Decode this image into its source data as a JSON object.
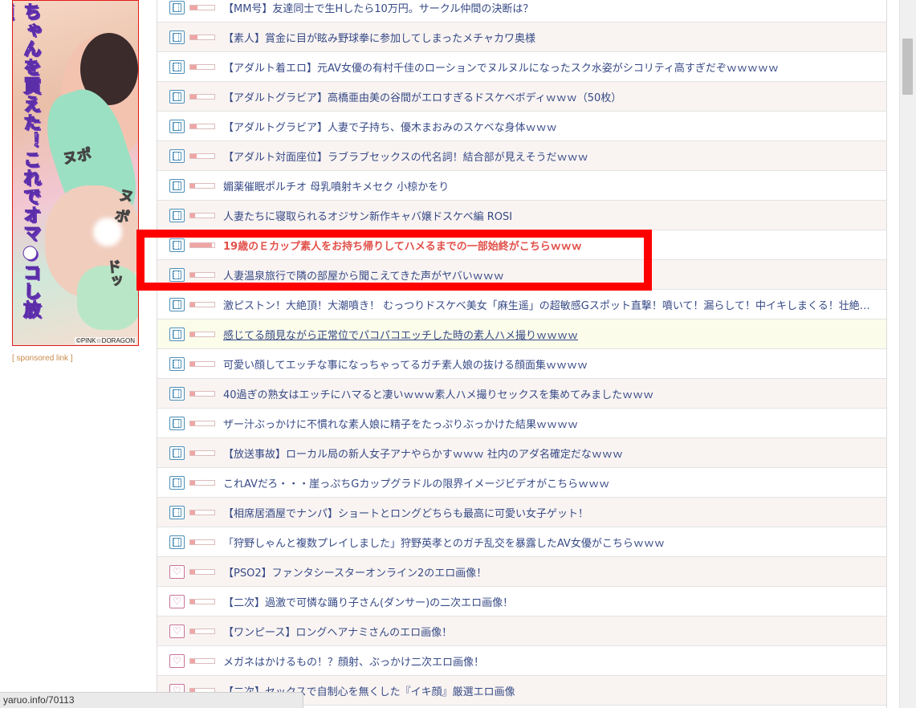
{
  "ad": {
    "banner_text": "ちゃんを買えた！これでオマ●コし放題!!",
    "sfx_1": "ヌポ",
    "sfx_2": "ヌポ",
    "sfx_3": "ドッ",
    "credit": "©PINK☆DORAGON",
    "sponsored_label": "[ sponsored link ]"
  },
  "list": {
    "rows": [
      {
        "icon": "film-icon",
        "popularity": 0.3,
        "title": "【MM号】友達同士で生Hしたら10万円。サークル仲間の決断は？"
      },
      {
        "icon": "film-icon",
        "popularity": 0.3,
        "title": "【素人】賞金に目が眩み野球拳に参加してしまったメチャカワ奥様"
      },
      {
        "icon": "film-icon",
        "popularity": 0.25,
        "title": "【アダルト着エロ】元AV女優の有村千佳のローションでヌルヌルになったスク水姿がシコリティ高すぎだぞｗｗｗｗｗ"
      },
      {
        "icon": "film-icon",
        "popularity": 0.25,
        "title": "【アダルトグラビア】高橋亜由美の谷間がエロすぎるドスケベボディｗｗｗ（50枚）"
      },
      {
        "icon": "film-icon",
        "popularity": 0.25,
        "title": "【アダルトグラビア】人妻で子持ち、優木まおみのスケベな身体ｗｗｗ"
      },
      {
        "icon": "film-icon",
        "popularity": 0.25,
        "title": "【アダルト対面座位】ラブラブセックスの代名詞！結合部が見えそうだｗｗｗ"
      },
      {
        "icon": "film-icon",
        "popularity": 0.2,
        "title": "媚薬催眠ポルチオ 母乳噴射キメセク 小椋かをり"
      },
      {
        "icon": "film-icon",
        "popularity": 0.2,
        "title": "人妻たちに寝取られるオジサン新作キャバ嬢ドスケベ編 ROSI"
      },
      {
        "icon": "film-icon",
        "popularity": 0.9,
        "title": "19歳のＥカップ素人をお持ち帰りしてハメるまでの一部始終がこちらｗｗｗ"
      },
      {
        "icon": "film-icon",
        "popularity": 0.2,
        "title": "人妻温泉旅行で隣の部屋から聞こえてきた声がヤバいｗｗｗ"
      },
      {
        "icon": "film-icon",
        "popularity": 0.2,
        "title": "激ピストン！大絶頂！大潮噴き！ むっつりドスケベ美女「麻生遥」の超敏感Gスポット直撃！噴いて！漏らして！中イキしまくる！壮絶失禁エンドレス"
      },
      {
        "icon": "film-icon",
        "popularity": 0.2,
        "title": "感じてる顔見ながら正常位でパコパコエッチした時の素人ハメ撮りｗｗｗｗ"
      },
      {
        "icon": "film-icon",
        "popularity": 0.2,
        "title": "可愛い顔してエッチな事になっちゃってるガチ素人娘の抜ける顔面集ｗｗｗｗ"
      },
      {
        "icon": "film-icon",
        "popularity": 0.2,
        "title": "40過ぎの熟女はエッチにハマると凄いｗｗｗ素人ハメ撮りセックスを集めてみましたｗｗｗ"
      },
      {
        "icon": "film-icon",
        "popularity": 0.2,
        "title": "ザー汁ぶっかけに不慣れな素人娘に精子をたっぷりぶっかけた結果ｗｗｗｗ"
      },
      {
        "icon": "film-icon",
        "popularity": 0.2,
        "title": "【放送事故】ローカル局の新人女子アナやらかすｗｗｗ 社内のアダ名確定だなｗｗｗ"
      },
      {
        "icon": "film-icon",
        "popularity": 0.2,
        "title": "これAVだろ・・・崖っぷちGカップグラドルの限界イメージビデオがこちらｗｗｗ"
      },
      {
        "icon": "film-icon",
        "popularity": 0.2,
        "title": "【相席居酒屋でナンパ】ショートとロングどちらも最高に可愛い女子ゲット！"
      },
      {
        "icon": "film-icon",
        "popularity": 0.2,
        "title": "「狩野しゃんと複数プレイしました」狩野英孝とのガチ乱交を暴露したAV女優がこちらｗｗｗ"
      },
      {
        "icon": "heart-icon",
        "popularity": 0.2,
        "title": "【PSO2】ファンタシースターオンライン2のエロ画像！"
      },
      {
        "icon": "heart-icon",
        "popularity": 0.2,
        "title": "【二次】過激で可憐な踊り子さん(ダンサー)の二次エロ画像！"
      },
      {
        "icon": "heart-icon",
        "popularity": 0.2,
        "title": "【ワンピース】ロングヘアナミさんのエロ画像！"
      },
      {
        "icon": "heart-icon",
        "popularity": 0.2,
        "title": "メガネはかけるもの！？顔射、ぶっかけ二次エロ画像！"
      },
      {
        "icon": "heart-icon",
        "popularity": 0.2,
        "title": "【二次】セックスで自制心を無くした『イキ顔』厳選エロ画像"
      }
    ]
  },
  "status_bar": {
    "url": "yaruo.info/70113"
  },
  "colors": {
    "link": "#374a86",
    "featured_link": "#e2504a",
    "annotation_box": "#ff0000",
    "film_icon": "#4d8fb8",
    "heart_icon": "#c9739a"
  }
}
